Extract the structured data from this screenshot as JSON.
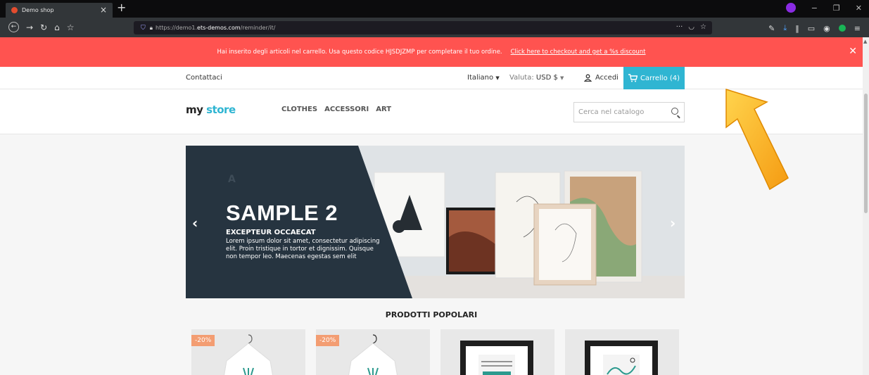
{
  "browser": {
    "tab_title": "Demo shop",
    "url_prefix": "https://demo1.",
    "url_host": "ets-demos.com",
    "url_path": "/reminder/it/"
  },
  "promo": {
    "message": "Hai inserito degli articoli nel carrello. Usa questo codice HJSDJZMP per completare il tuo ordine.",
    "link_text": "Click here to checkout and get a %s discount",
    "bg_color": "#ff5350"
  },
  "topnav": {
    "contact": "Contattaci",
    "language": "Italiano",
    "currency_label": "Valuta:",
    "currency_value": "USD $",
    "login": "Accedi",
    "cart": "Carrello (4)"
  },
  "header": {
    "logo_my": "my",
    "logo_store": "store",
    "menu": [
      "CLOTHES",
      "ACCESSORI",
      "ART"
    ],
    "search_placeholder": "Cerca nel catalogo"
  },
  "slider": {
    "title": "SAMPLE 2",
    "subtitle": "EXCEPTEUR OCCAECAT",
    "body": "Lorem ipsum dolor sit amet, consectetur adipiscing elit. Proin tristique in tortor et dignissim. Quisque non tempor leo. Maecenas egestas sem elit"
  },
  "popular": {
    "title": "PRODOTTI POPOLARI",
    "badges": [
      "-20%",
      "-20%"
    ]
  },
  "colors": {
    "accent": "#2fb5d2",
    "slide_dark": "#263440"
  }
}
